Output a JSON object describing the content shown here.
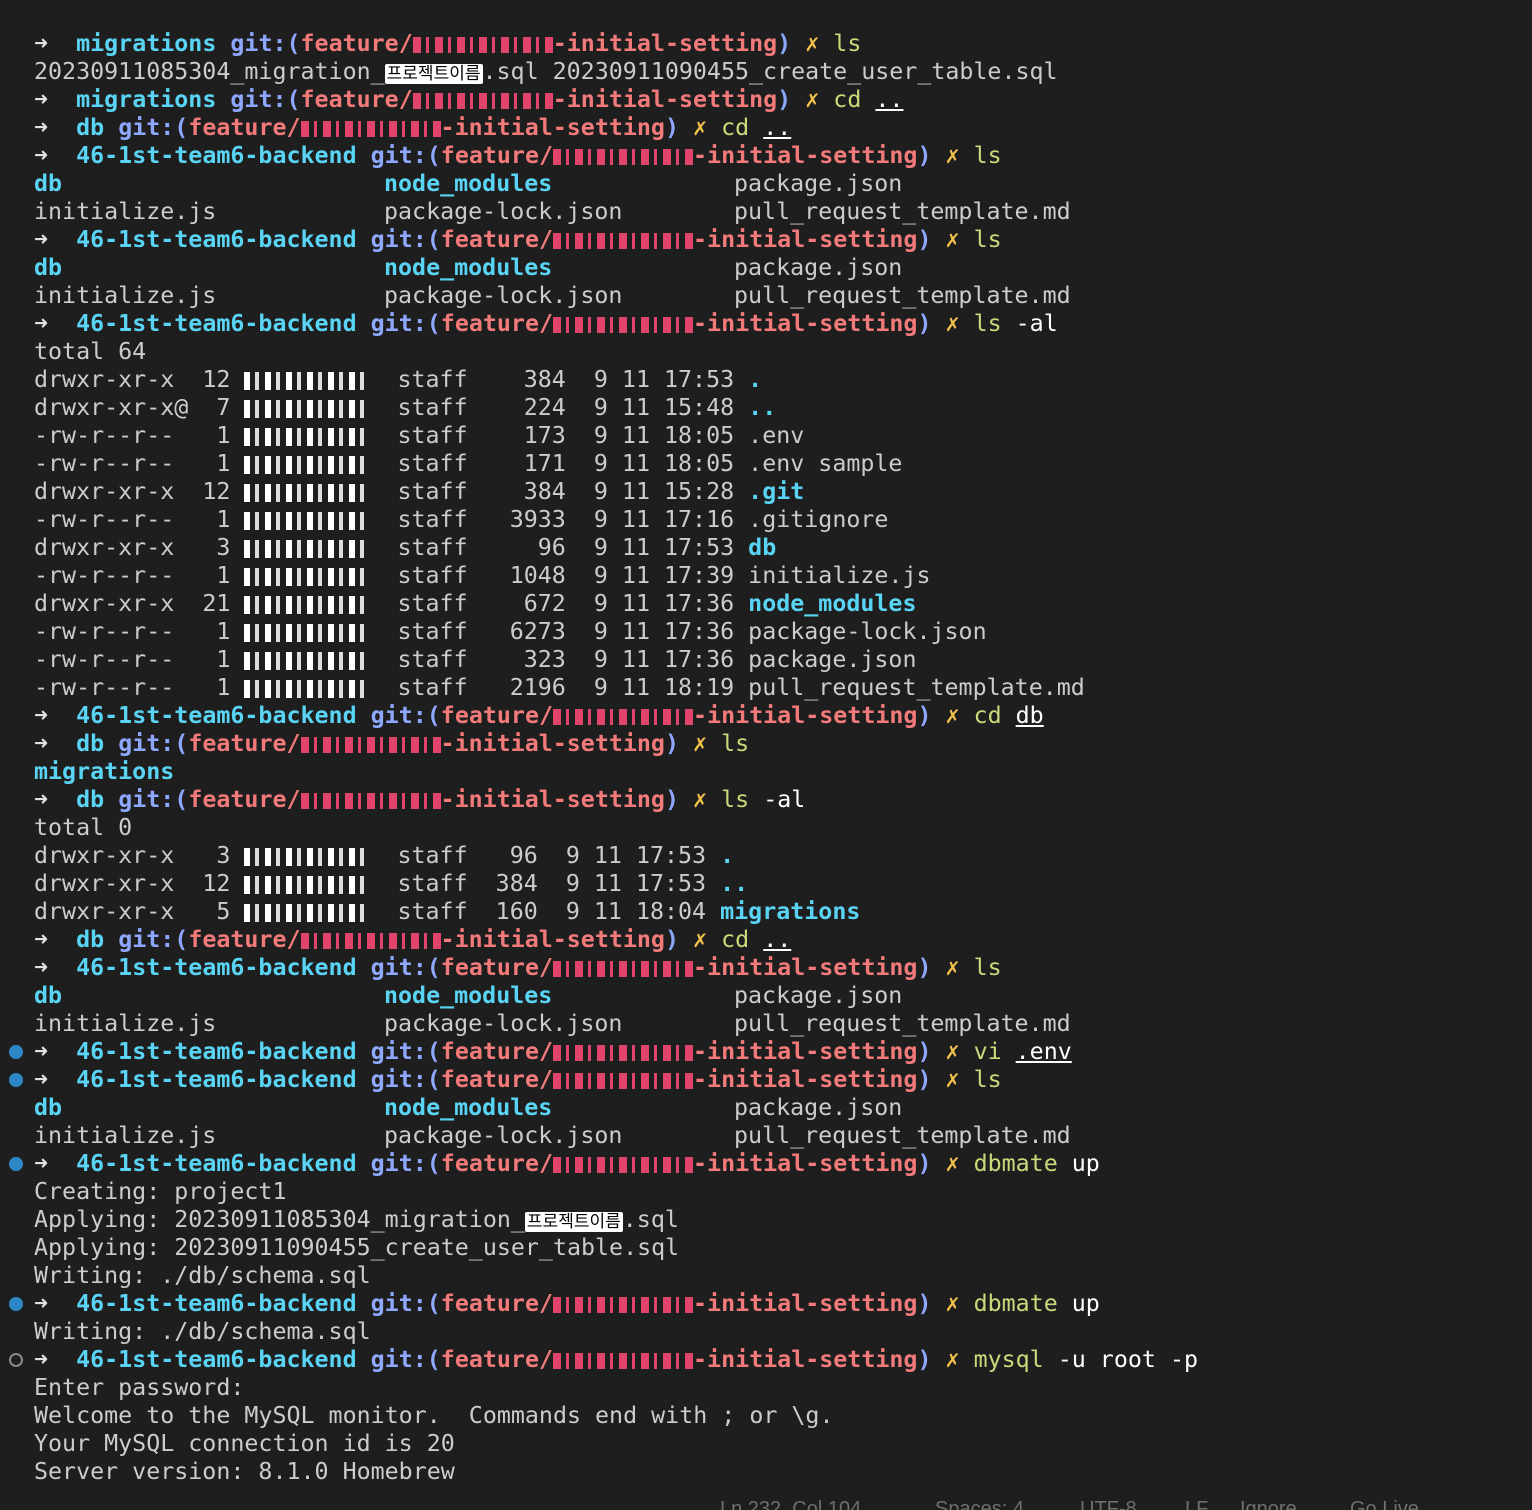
{
  "colors": {
    "background": "#1e1e1e",
    "dir": "#5ad4f5",
    "git": "#8fa8ff",
    "branch": "#f27a7a",
    "x": "#f2c14b",
    "cmd": "#ccd97a",
    "decoration": "#2e88c7"
  },
  "prompt": {
    "arrow": "➜",
    "git_open": "git:(",
    "git_close": ")",
    "x": "✗",
    "branch_prefix": "feature/",
    "branch_suffix": "-initial-setting"
  },
  "lines": [
    {
      "t": "p",
      "dir": "migrations",
      "cmd": "ls"
    },
    {
      "t": "o",
      "parts": [
        {
          "s": "20230911085304_migration_"
        },
        {
          "s": "프로젝트이름",
          "cls": "label"
        },
        {
          "s": ".sql 20230911090455_create_user_table.sql"
        }
      ]
    },
    {
      "t": "p",
      "dir": "migrations",
      "cmd": "cd",
      "arg": "..",
      "u": true
    },
    {
      "t": "p",
      "dir": "db",
      "cmd": "cd",
      "arg": "..",
      "u": true
    },
    {
      "t": "p",
      "dir": "46-1st-team6-backend",
      "cmd": "ls"
    },
    {
      "t": "c",
      "cols": [
        {
          "s": "db",
          "f": true
        },
        {
          "s": "node_modules",
          "f": true
        },
        {
          "s": "package.json"
        }
      ]
    },
    {
      "t": "c",
      "cols": [
        {
          "s": "initialize.js"
        },
        {
          "s": "package-lock.json"
        },
        {
          "s": "pull_request_template.md"
        }
      ]
    },
    {
      "t": "p",
      "dir": "46-1st-team6-backend",
      "cmd": "ls"
    },
    {
      "t": "c",
      "cols": [
        {
          "s": "db",
          "f": true
        },
        {
          "s": "node_modules",
          "f": true
        },
        {
          "s": "package.json"
        }
      ]
    },
    {
      "t": "c",
      "cols": [
        {
          "s": "initialize.js"
        },
        {
          "s": "package-lock.json"
        },
        {
          "s": "pull_request_template.md"
        }
      ]
    },
    {
      "t": "p",
      "dir": "46-1st-team6-backend",
      "cmd": "ls",
      "arg": "-al"
    },
    {
      "t": "o",
      "parts": [
        {
          "s": "total 64"
        }
      ]
    },
    {
      "t": "l",
      "perm": "drwxr-xr-x ",
      "links": "12",
      "group": "staff",
      "size": "   384",
      "date": "9 11 17:53",
      "name": ".",
      "f": true
    },
    {
      "t": "l",
      "perm": "drwxr-xr-x@",
      "links": " 7",
      "group": "staff",
      "size": "   224",
      "date": "9 11 15:48",
      "name": "..",
      "f": true
    },
    {
      "t": "l",
      "perm": "-rw-r--r-- ",
      "links": " 1",
      "group": "staff",
      "size": "   173",
      "date": "9 11 18:05",
      "name": ".env"
    },
    {
      "t": "l",
      "perm": "-rw-r--r-- ",
      "links": " 1",
      "group": "staff",
      "size": "   171",
      "date": "9 11 18:05",
      "name": ".env sample"
    },
    {
      "t": "l",
      "perm": "drwxr-xr-x ",
      "links": "12",
      "group": "staff",
      "size": "   384",
      "date": "9 11 15:28",
      "name": ".git",
      "f": true
    },
    {
      "t": "l",
      "perm": "-rw-r--r-- ",
      "links": " 1",
      "group": "staff",
      "size": "  3933",
      "date": "9 11 17:16",
      "name": ".gitignore"
    },
    {
      "t": "l",
      "perm": "drwxr-xr-x ",
      "links": " 3",
      "group": "staff",
      "size": "    96",
      "date": "9 11 17:53",
      "name": "db",
      "f": true
    },
    {
      "t": "l",
      "perm": "-rw-r--r-- ",
      "links": " 1",
      "group": "staff",
      "size": "  1048",
      "date": "9 11 17:39",
      "name": "initialize.js"
    },
    {
      "t": "l",
      "perm": "drwxr-xr-x ",
      "links": "21",
      "group": "staff",
      "size": "   672",
      "date": "9 11 17:36",
      "name": "node_modules",
      "f": true
    },
    {
      "t": "l",
      "perm": "-rw-r--r-- ",
      "links": " 1",
      "group": "staff",
      "size": "  6273",
      "date": "9 11 17:36",
      "name": "package-lock.json"
    },
    {
      "t": "l",
      "perm": "-rw-r--r-- ",
      "links": " 1",
      "group": "staff",
      "size": "   323",
      "date": "9 11 17:36",
      "name": "package.json"
    },
    {
      "t": "l",
      "perm": "-rw-r--r-- ",
      "links": " 1",
      "group": "staff",
      "size": "  2196",
      "date": "9 11 18:19",
      "name": "pull_request_template.md"
    },
    {
      "t": "p",
      "dir": "46-1st-team6-backend",
      "cmd": "cd",
      "arg": "db",
      "u": true
    },
    {
      "t": "p",
      "dir": "db",
      "cmd": "ls"
    },
    {
      "t": "o",
      "parts": [
        {
          "s": "migrations",
          "cls": "folder"
        }
      ]
    },
    {
      "t": "p",
      "dir": "db",
      "cmd": "ls",
      "arg": "-al"
    },
    {
      "t": "o",
      "parts": [
        {
          "s": "total 0"
        }
      ]
    },
    {
      "t": "l",
      "perm": "drwxr-xr-x ",
      "links": " 3",
      "group": "staff",
      "size": "  96",
      "date": "9 11 17:53",
      "name": ".",
      "f": true
    },
    {
      "t": "l",
      "perm": "drwxr-xr-x ",
      "links": "12",
      "group": "staff",
      "size": " 384",
      "date": "9 11 17:53",
      "name": "..",
      "f": true
    },
    {
      "t": "l",
      "perm": "drwxr-xr-x ",
      "links": " 5",
      "group": "staff",
      "size": " 160",
      "date": "9 11 18:04",
      "name": "migrations",
      "f": true
    },
    {
      "t": "p",
      "dir": "db",
      "cmd": "cd",
      "arg": "..",
      "u": true
    },
    {
      "t": "p",
      "dir": "46-1st-team6-backend",
      "cmd": "ls"
    },
    {
      "t": "c",
      "cols": [
        {
          "s": "db",
          "f": true
        },
        {
          "s": "node_modules",
          "f": true
        },
        {
          "s": "package.json"
        }
      ]
    },
    {
      "t": "c",
      "cols": [
        {
          "s": "initialize.js"
        },
        {
          "s": "package-lock.json"
        },
        {
          "s": "pull_request_template.md"
        }
      ]
    },
    {
      "t": "p",
      "dir": "46-1st-team6-backend",
      "cmd": "vi",
      "arg": ".env",
      "u": true,
      "deco": "filled"
    },
    {
      "t": "p",
      "dir": "46-1st-team6-backend",
      "cmd": "ls",
      "deco": "filled"
    },
    {
      "t": "c",
      "cols": [
        {
          "s": "db",
          "f": true
        },
        {
          "s": "node_modules",
          "f": true
        },
        {
          "s": "package.json"
        }
      ]
    },
    {
      "t": "c",
      "cols": [
        {
          "s": "initialize.js"
        },
        {
          "s": "package-lock.json"
        },
        {
          "s": "pull_request_template.md"
        }
      ]
    },
    {
      "t": "p",
      "dir": "46-1st-team6-backend",
      "cmd": "dbmate",
      "arg": "up",
      "deco": "filled"
    },
    {
      "t": "o",
      "parts": [
        {
          "s": "Creating: project1"
        }
      ]
    },
    {
      "t": "o",
      "parts": [
        {
          "s": "Applying: 20230911085304_migration_"
        },
        {
          "s": "프로젝트이름",
          "cls": "label"
        },
        {
          "s": ".sql"
        }
      ]
    },
    {
      "t": "o",
      "parts": [
        {
          "s": "Applying: 20230911090455_create_user_table.sql"
        }
      ]
    },
    {
      "t": "o",
      "parts": [
        {
          "s": "Writing: ./db/schema.sql"
        }
      ]
    },
    {
      "t": "p",
      "dir": "46-1st-team6-backend",
      "cmd": "dbmate",
      "arg": "up",
      "deco": "filled"
    },
    {
      "t": "o",
      "parts": [
        {
          "s": "Writing: ./db/schema.sql"
        }
      ]
    },
    {
      "t": "p",
      "dir": "46-1st-team6-backend",
      "cmd": "mysql",
      "arg": "-u root -p",
      "deco": "hollow"
    },
    {
      "t": "o",
      "parts": [
        {
          "s": "Enter password:"
        }
      ]
    },
    {
      "t": "o",
      "parts": [
        {
          "s": "Welcome to the MySQL monitor.  Commands end with ; or \\g."
        }
      ]
    },
    {
      "t": "o",
      "parts": [
        {
          "s": "Your MySQL connection id is 20"
        }
      ]
    },
    {
      "t": "o",
      "parts": [
        {
          "s": "Server version: 8.1.0 Homebrew"
        }
      ]
    }
  ],
  "status_bar": {
    "position": "Ln 232, Col 104",
    "spaces": "Spaces: 4",
    "encoding": "UTF-8",
    "eol": "LF",
    "ignore": "Ignore",
    "golive": "Go Live"
  }
}
